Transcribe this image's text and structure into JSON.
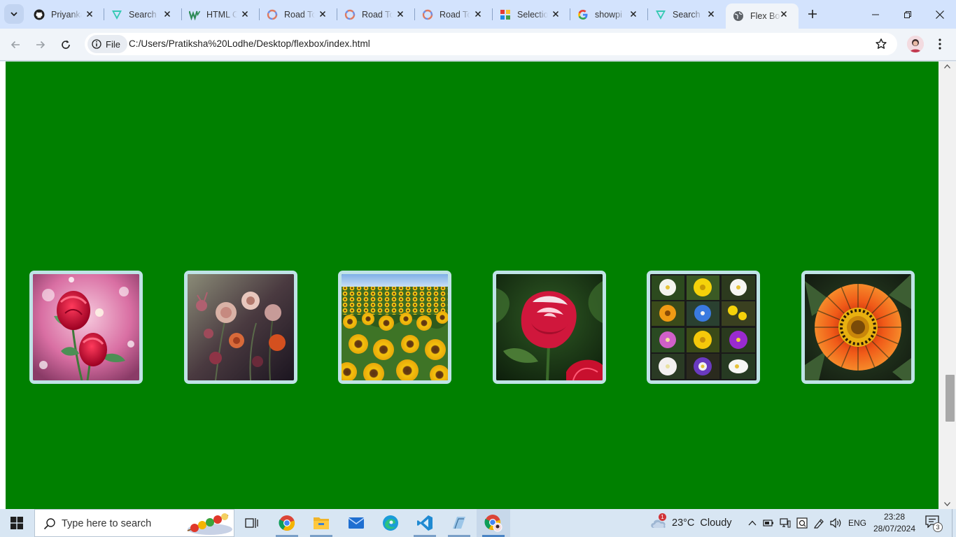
{
  "browser": {
    "tabs": [
      {
        "title": "Priyanka",
        "icon": "github-icon",
        "active": false
      },
      {
        "title": "Search",
        "icon": "vite-icon",
        "active": false
      },
      {
        "title": "HTML C",
        "icon": "w-icon",
        "active": false
      },
      {
        "title": "Road To",
        "icon": "circle-logo-icon",
        "active": false
      },
      {
        "title": "Road To",
        "icon": "circle-logo-icon",
        "active": false
      },
      {
        "title": "Road To",
        "icon": "circle-logo-icon",
        "active": false
      },
      {
        "title": "Selection",
        "icon": "grid-logo-icon",
        "active": false
      },
      {
        "title": "showpi",
        "icon": "google-icon",
        "active": false
      },
      {
        "title": "Search",
        "icon": "vite-icon",
        "active": false
      },
      {
        "title": "Flex Bo",
        "icon": "globe-icon",
        "active": true
      }
    ],
    "address": {
      "scheme_chip": "File",
      "url": "C:/Users/Pratiksha%20Lodhe/Desktop/flexbox/index.html"
    }
  },
  "page": {
    "background_color": "#008000",
    "card_border_color": "#bfe3e6",
    "images": [
      {
        "subject": "red roses with bokeh"
      },
      {
        "subject": "dark moody flowers"
      },
      {
        "subject": "sunflower field"
      },
      {
        "subject": "red and white rose"
      },
      {
        "subject": "flower collage grid"
      },
      {
        "subject": "orange gazania flower"
      }
    ]
  },
  "taskbar": {
    "search_placeholder": "Type here to search",
    "weather": {
      "temp": "23°C",
      "condition": "Cloudy",
      "alert_count": "1"
    },
    "language": "ENG",
    "time": "23:28",
    "date": "28/07/2024",
    "notification_count": "3"
  }
}
